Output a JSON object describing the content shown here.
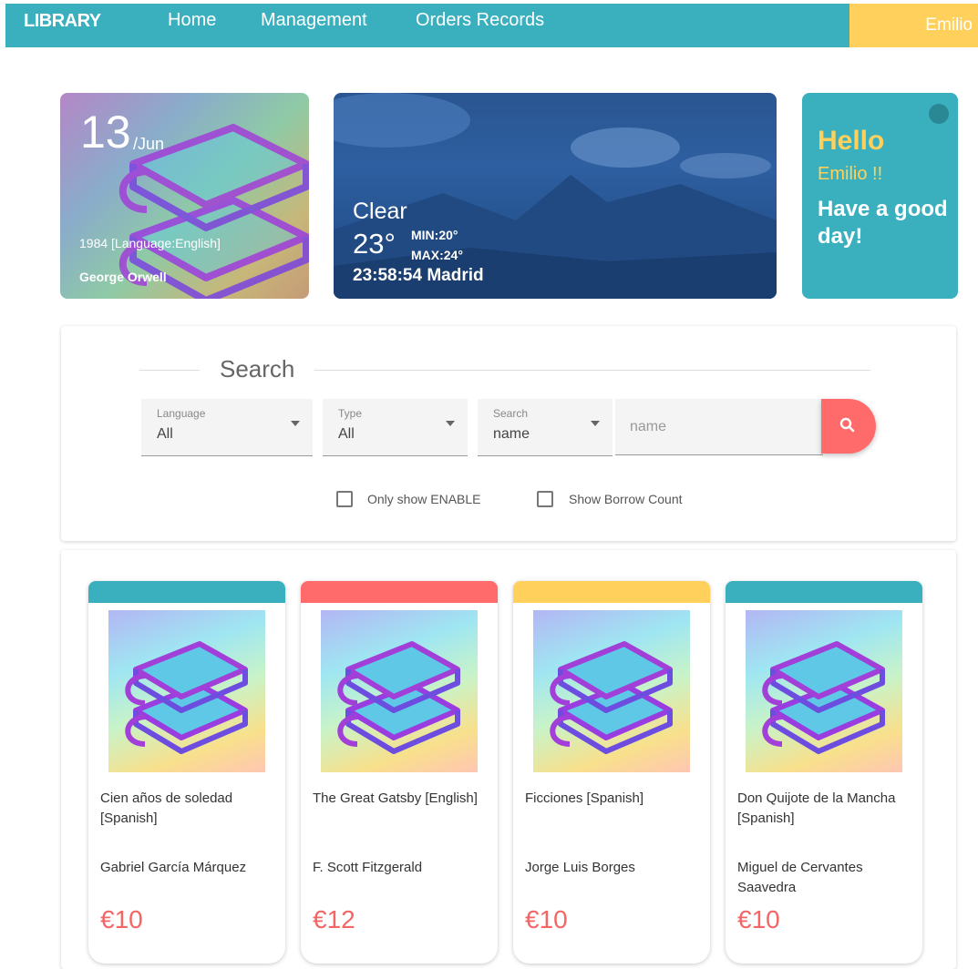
{
  "nav": {
    "logo": "LIBRARY",
    "links": [
      "Home",
      "Management",
      "Orders Records"
    ],
    "user": "Emilio"
  },
  "featured": {
    "day": "13",
    "month": "/Jun",
    "title": "1984 [Language:English]",
    "author": "George Orwell"
  },
  "weather": {
    "condition": "Clear",
    "temp": "23°",
    "min": "MIN:20°",
    "max": "MAX:24°",
    "time_city": "23:58:54 Madrid"
  },
  "greeting": {
    "hello": "Hello",
    "name": "Emilio !!",
    "message": "Have a good day!"
  },
  "search": {
    "title": "Search",
    "language": {
      "label": "Language",
      "value": "All"
    },
    "type": {
      "label": "Type",
      "value": "All"
    },
    "field": {
      "label": "Search",
      "value": "name"
    },
    "placeholder": "name",
    "only_enable": "Only show ENABLE",
    "borrow_count": "Show Borrow Count"
  },
  "colors": {
    "teal": "#3ab0bf",
    "yellow": "#ffd15c",
    "red": "#ff6b6b",
    "price": "#f46565"
  },
  "books": [
    {
      "title": "Cien años de soledad [Spanish]",
      "author": "Gabriel García Márquez",
      "price": "€10",
      "band": "#3ab0bf"
    },
    {
      "title": "The Great Gatsby [English]",
      "author": "F. Scott Fitzgerald",
      "price": "€12",
      "band": "#ff6b6b"
    },
    {
      "title": "Ficciones [Spanish]",
      "author": "Jorge Luis Borges",
      "price": "€10",
      "band": "#ffd15c"
    },
    {
      "title": "Don Quijote de la Mancha [Spanish]",
      "author": "Miguel de Cervantes Saavedra",
      "price": "€10",
      "band": "#3ab0bf"
    }
  ]
}
